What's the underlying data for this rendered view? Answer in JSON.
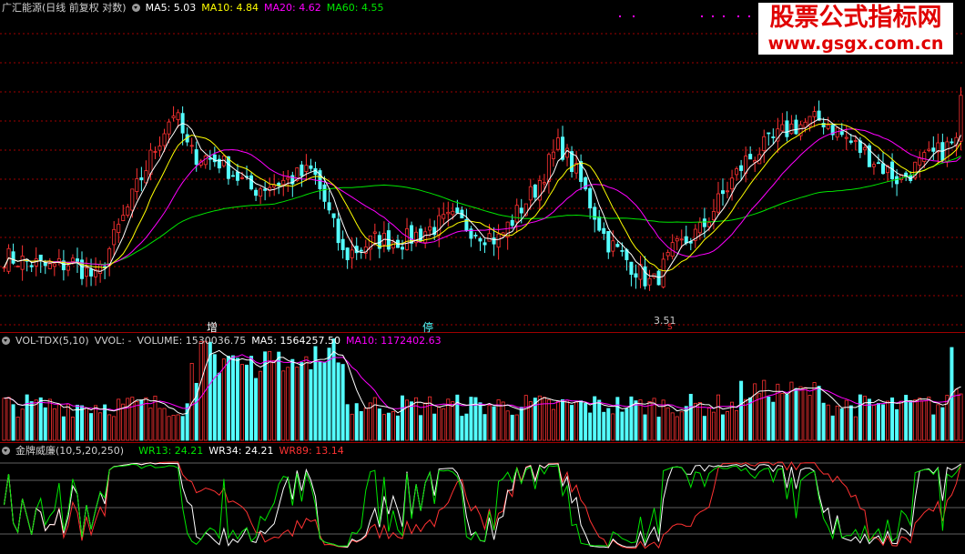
{
  "main_header": {
    "title": "广汇能源(日线 前复权 对数)",
    "ma5": "MA5: 5.03",
    "ma10": "MA10: 4.84",
    "ma20": "MA20: 4.62",
    "ma60": "MA60: 4.55"
  },
  "vol_header": {
    "title": "VOL-TDX(5,10)",
    "vvol": "VVOL: -",
    "volume": "VOLUME: 1530036.75",
    "ma5": "MA5: 1564257.50",
    "ma10": "MA10: 1172402.63"
  },
  "wr_header": {
    "title": "金牌威廉(10,5,20,250)",
    "wr13": "WR13: 24.21",
    "wr34": "WR34: 24.21",
    "wr89": "WR89: 13.14"
  },
  "watermark": {
    "line1": "股票公式指标网",
    "line2": "www.gsgx.com.cn"
  },
  "markers": {
    "zeng": "增",
    "ting": "停",
    "low_label": "3.51",
    "s_label": "S"
  },
  "colors": {
    "up": "#ff3232",
    "down": "#54ffff",
    "ma5": "#ffffff",
    "ma10": "#ffff00",
    "ma20": "#ff00ff",
    "ma60": "#00e600",
    "wr13": "#00e600",
    "wr34": "#ffffff",
    "wr89": "#ff3232",
    "grid": "#a00000"
  },
  "chart_data": [
    {
      "type": "candlestick",
      "name": "price",
      "scale": "log",
      "count": 210,
      "low_close": 3.51,
      "ma_last": {
        "MA5": 5.03,
        "MA10": 4.84,
        "MA20": 4.62,
        "MA60": 4.55
      }
    },
    {
      "type": "bar",
      "name": "volume",
      "last": 1530036.75,
      "ma5_last": 1564257.5,
      "ma10_last": 1172402.63
    },
    {
      "type": "line",
      "name": "williams %R",
      "last": {
        "WR13": 24.21,
        "WR34": 24.21,
        "WR89": 13.14
      }
    }
  ]
}
